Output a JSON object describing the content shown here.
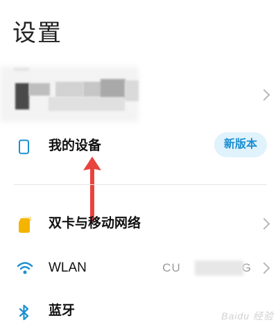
{
  "header": {
    "title": "设置"
  },
  "rows": {
    "my_device": {
      "label": "我的设备",
      "badge": "新版本",
      "icon": "phone-outline-icon"
    },
    "dual_sim": {
      "label": "双卡与移动网络",
      "icon": "sim-card-icon"
    },
    "wlan": {
      "label": "WLAN",
      "value_start": "CU",
      "value_end": "G",
      "icon": "wifi-icon"
    },
    "bluetooth": {
      "label": "蓝牙",
      "icon": "bluetooth-icon"
    }
  },
  "colors": {
    "accent": "#1a8fd1",
    "badge_bg": "#e0f2fb",
    "arrow": "#e8443d",
    "sim_yellow": "#f4b400"
  },
  "watermark": "Baidu 经验"
}
